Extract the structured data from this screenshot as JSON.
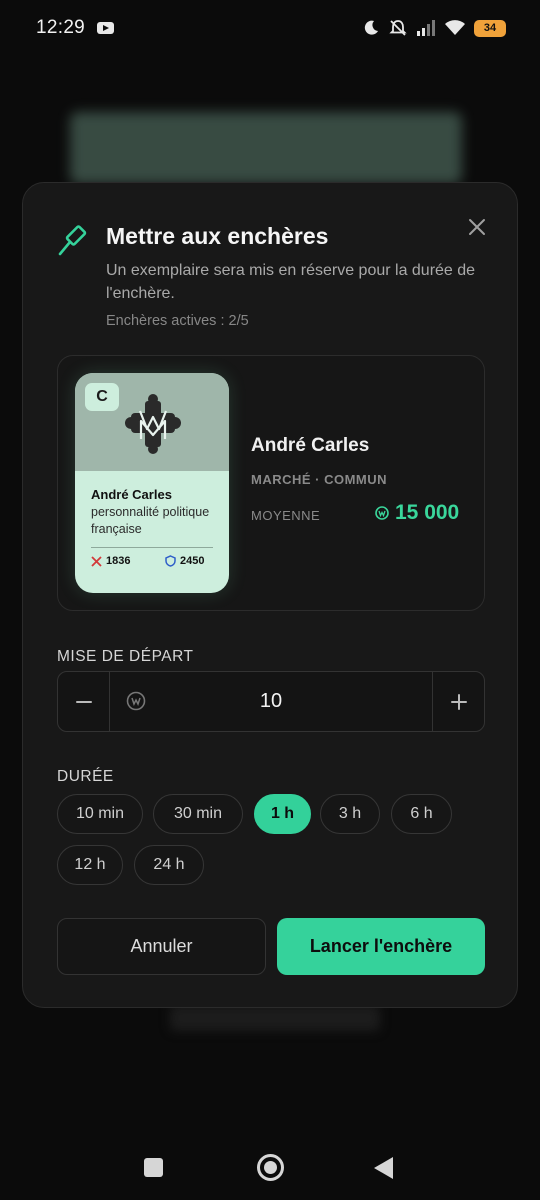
{
  "status_bar": {
    "time": "12:29",
    "battery": "34",
    "icons": [
      "youtube-icon",
      "moon-icon",
      "bell-off-icon",
      "signal-icon",
      "wifi-icon",
      "battery-icon"
    ]
  },
  "modal": {
    "title": "Mettre aux enchères",
    "description": "Un exemplaire sera mis en réserve pour la durée de l'enchère.",
    "active_auctions": "Enchères actives : 2/5",
    "accent_color": "#35d29b"
  },
  "card": {
    "rarity": "C",
    "name": "André Carles",
    "description": "personnalité politique française",
    "attack": "1836",
    "defense": "2450",
    "meta": "MARCHÉ · COMMUN",
    "average_label": "MOYENNE",
    "average_price": "15 000"
  },
  "bid": {
    "label": "MISE DE DÉPART",
    "value": "10",
    "minus": "−",
    "plus": "+"
  },
  "duration": {
    "label": "DURÉE",
    "options": [
      "10 min",
      "30 min",
      "1 h",
      "3 h",
      "6 h",
      "12 h",
      "24 h"
    ],
    "selected": "1 h"
  },
  "actions": {
    "cancel": "Annuler",
    "launch": "Lancer l'enchère"
  }
}
